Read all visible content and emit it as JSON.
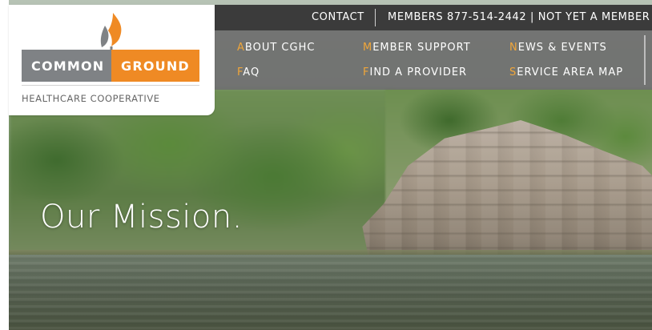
{
  "header": {
    "utility": {
      "contact": "CONTACT",
      "members": "MEMBERS 877-514-2442 | NOT YET A MEMBER"
    },
    "nav": {
      "items": [
        {
          "first": "A",
          "rest": "BOUT CGHC"
        },
        {
          "first": "M",
          "rest": "EMBER SUPPORT"
        },
        {
          "first": "N",
          "rest": "EWS & EVENTS"
        },
        {
          "first": "F",
          "rest": "AQ"
        },
        {
          "first": "F",
          "rest": "IND A PROVIDER"
        },
        {
          "first": "S",
          "rest": "ERVICE AREA MAP"
        }
      ]
    }
  },
  "logo": {
    "left_word": "COMMON",
    "right_word": "GROUND",
    "subtitle": "HEALTHCARE COOPERATIVE"
  },
  "hero": {
    "headline": "Our Mission."
  },
  "colors": {
    "accent_orange": "#ef8a24",
    "logo_gray": "#7f8285",
    "utility_bar": "#3b3b3b",
    "nav_bg": "#6e6e6e"
  }
}
